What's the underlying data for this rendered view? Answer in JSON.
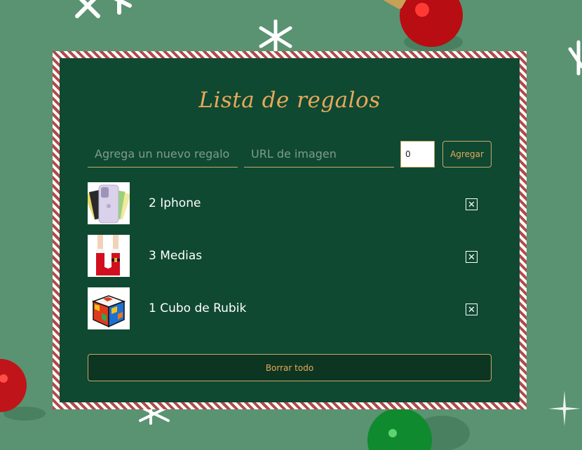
{
  "app": {
    "title": "Lista de regalos"
  },
  "form": {
    "gift_placeholder": "Agrega un nuevo regalo",
    "gift_value": "",
    "url_placeholder": "URL de imagen",
    "url_value": "",
    "quantity_value": "0",
    "add_label": "Agregar"
  },
  "gifts": [
    {
      "label": "2 Iphone",
      "quantity": 2,
      "name": "Iphone",
      "icon": "phone-image",
      "delete_label": "✕"
    },
    {
      "label": "3 Medias",
      "quantity": 3,
      "name": "Medias",
      "icon": "socks-image",
      "delete_label": "✕"
    },
    {
      "label": "1 Cubo de Rubik",
      "quantity": 1,
      "name": "Cubo de Rubik",
      "icon": "rubik-cube-image",
      "delete_label": "✕"
    }
  ],
  "footer": {
    "clear_label": "Borrar todo"
  },
  "colors": {
    "background": "#5a9372",
    "card": "#0f4931",
    "accent": "#e9a85a",
    "border_red": "#b24a4a"
  }
}
